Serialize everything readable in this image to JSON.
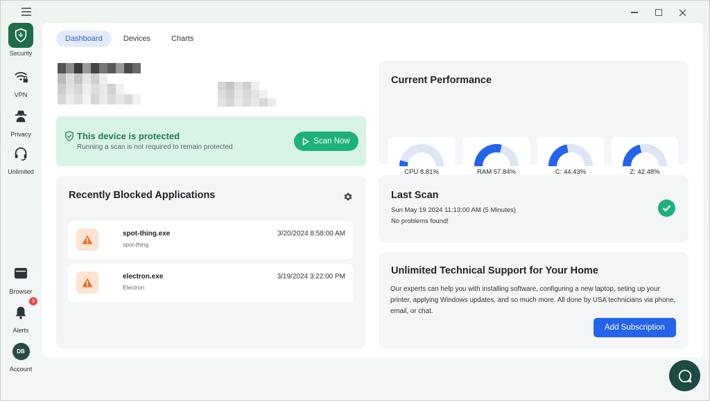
{
  "app": {
    "menu_icon": "hamburger-icon",
    "window_controls": [
      "minimize-icon",
      "maximize-icon",
      "close-icon"
    ]
  },
  "sidebar": {
    "items": [
      {
        "label": "Security",
        "icon": "shield-icon",
        "active": true
      },
      {
        "label": "VPN",
        "icon": "wifi-lock-icon"
      },
      {
        "label": "Privacy",
        "icon": "spy-icon"
      },
      {
        "label": "Unlimited",
        "icon": "headset-icon"
      }
    ],
    "bottom": [
      {
        "label": "Browser",
        "icon": "browser-icon"
      },
      {
        "label": "Alerts",
        "icon": "bell-icon",
        "badge": "3"
      },
      {
        "label": "Account",
        "avatar": "DB"
      }
    ]
  },
  "tabs": [
    "Dashboard",
    "Devices",
    "Charts"
  ],
  "protection": {
    "title": "This device is protected",
    "subtitle": "Running a scan is not required to remain protected",
    "button": "Scan Now"
  },
  "blocked": {
    "title": "Recently Blocked Applications",
    "items": [
      {
        "name": "spot-thing.exe",
        "publisher": "spot-thing",
        "date": "3/20/2024 8:58:00 AM"
      },
      {
        "name": "electron.exe",
        "publisher": "Electron",
        "date": "3/19/2024 3:22:00 PM"
      }
    ]
  },
  "performance": {
    "title": "Current Performance",
    "metrics": [
      {
        "label": "CPU 8.81%",
        "value": 8.81
      },
      {
        "label": "RAM 57.84%",
        "value": 57.84
      },
      {
        "label": "C: 44.43%",
        "value": 44.43
      },
      {
        "label": "Z: 42.48%",
        "value": 42.48
      }
    ],
    "colors": {
      "fill": "#2563eb",
      "track": "#dde6f2"
    }
  },
  "last_scan": {
    "title": "Last Scan",
    "time": "Sun May 19 2024 11:13:00 AM (5 Minutes)",
    "result": "No problems found!"
  },
  "support": {
    "title": "Unlimited Technical Support for Your Home",
    "text": "Our experts can help you with installing software, configuring a new laptop, seting up your printer, applying Windows updates, and so much more. All done by USA technicians via phone, email, or chat.",
    "button": "Add Subscription"
  },
  "colors": {
    "brand": "#1e6c4a",
    "success": "#1db07a",
    "primary": "#2563eb",
    "warning": "#e8702a"
  }
}
